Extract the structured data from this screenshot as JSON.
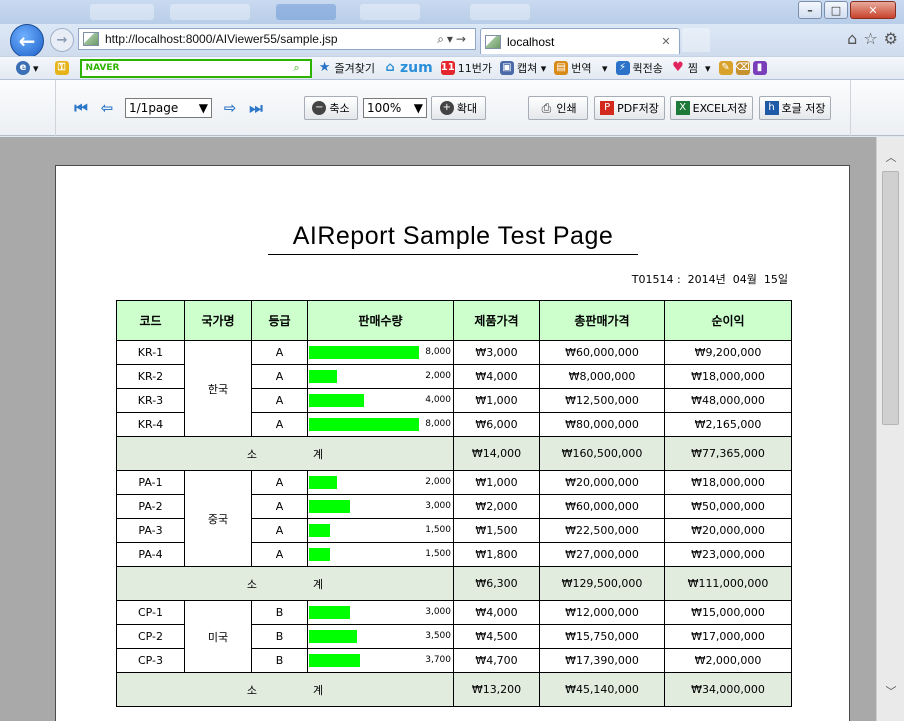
{
  "browser": {
    "address_url": "http://localhost:8000/AIViewer55/sample.jsp",
    "tab_title": "localhost",
    "search_brand": "NAVER",
    "toolbar_links": [
      {
        "label": "즐겨찾기",
        "icon": "star-icon",
        "color": "#2a73c9"
      },
      {
        "label": "zum",
        "icon": "zum-logo-icon",
        "color": "#2a8fd9"
      },
      {
        "label": "11번가",
        "icon": "11st-icon",
        "color": "#e5272d"
      },
      {
        "label": "캡쳐",
        "icon": "capture-icon",
        "color": "#4a6aa8"
      },
      {
        "label": "번역",
        "icon": "translate-icon",
        "color": "#d98b1a"
      },
      {
        "label": "퀵전송",
        "icon": "quick-send-icon",
        "color": "#2a73c9"
      },
      {
        "label": "찜",
        "icon": "heart-icon",
        "color": "#e0245e"
      }
    ]
  },
  "viewer": {
    "page_select_value": "1/1page",
    "zoom_out_label": "축소",
    "zoom_value": "100%",
    "zoom_in_label": "확대",
    "print_label": "인쇄",
    "pdf_label": "PDF저장",
    "excel_label": "EXCEL저장",
    "hwp_label": "호글 저장"
  },
  "report": {
    "title": "AIReport Sample Test Page",
    "meta": "T01514 :  2014년  04월  15일",
    "headers": [
      "코드",
      "국가명",
      "등급",
      "판매수량",
      "제품가격",
      "총판매가격",
      "순이익"
    ],
    "subtotal_label_1": "소",
    "subtotal_label_2": "계",
    "groups": [
      {
        "country": "한국",
        "rows": [
          {
            "code": "KR-1",
            "grade": "A",
            "qty": 8000,
            "qty_label": "8,000",
            "price": "₩3,000",
            "total": "₩60,000,000",
            "profit": "₩9,200,000"
          },
          {
            "code": "KR-2",
            "grade": "A",
            "qty": 2000,
            "qty_label": "2,000",
            "price": "₩4,000",
            "total": "₩8,000,000",
            "profit": "₩18,000,000"
          },
          {
            "code": "KR-3",
            "grade": "A",
            "qty": 4000,
            "qty_label": "4,000",
            "price": "₩1,000",
            "total": "₩12,500,000",
            "profit": "₩48,000,000"
          },
          {
            "code": "KR-4",
            "grade": "A",
            "qty": 8000,
            "qty_label": "8,000",
            "price": "₩6,000",
            "total": "₩80,000,000",
            "profit": "₩2,165,000"
          }
        ],
        "subtotal": {
          "price": "₩14,000",
          "total": "₩160,500,000",
          "profit": "₩77,365,000"
        }
      },
      {
        "country": "중국",
        "rows": [
          {
            "code": "PA-1",
            "grade": "A",
            "qty": 2000,
            "qty_label": "2,000",
            "price": "₩1,000",
            "total": "₩20,000,000",
            "profit": "₩18,000,000"
          },
          {
            "code": "PA-2",
            "grade": "A",
            "qty": 3000,
            "qty_label": "3,000",
            "price": "₩2,000",
            "total": "₩60,000,000",
            "profit": "₩50,000,000"
          },
          {
            "code": "PA-3",
            "grade": "A",
            "qty": 1500,
            "qty_label": "1,500",
            "price": "₩1,500",
            "total": "₩22,500,000",
            "profit": "₩20,000,000"
          },
          {
            "code": "PA-4",
            "grade": "A",
            "qty": 1500,
            "qty_label": "1,500",
            "price": "₩1,800",
            "total": "₩27,000,000",
            "profit": "₩23,000,000"
          }
        ],
        "subtotal": {
          "price": "₩6,300",
          "total": "₩129,500,000",
          "profit": "₩111,000,000"
        }
      },
      {
        "country": "미국",
        "rows": [
          {
            "code": "CP-1",
            "grade": "B",
            "qty": 3000,
            "qty_label": "3,000",
            "price": "₩4,000",
            "total": "₩12,000,000",
            "profit": "₩15,000,000"
          },
          {
            "code": "CP-2",
            "grade": "B",
            "qty": 3500,
            "qty_label": "3,500",
            "price": "₩4,500",
            "total": "₩15,750,000",
            "profit": "₩17,000,000"
          },
          {
            "code": "CP-3",
            "grade": "B",
            "qty": 3700,
            "qty_label": "3,700",
            "price": "₩4,700",
            "total": "₩17,390,000",
            "profit": "₩2,000,000"
          }
        ],
        "subtotal": {
          "price": "₩13,200",
          "total": "₩45,140,000",
          "profit": "₩34,000,000"
        }
      }
    ],
    "qty_bar_max": 8000,
    "bar_color": "#00ff00",
    "header_bg": "#ccffcc",
    "subtotal_bg": "#e1ebde"
  }
}
